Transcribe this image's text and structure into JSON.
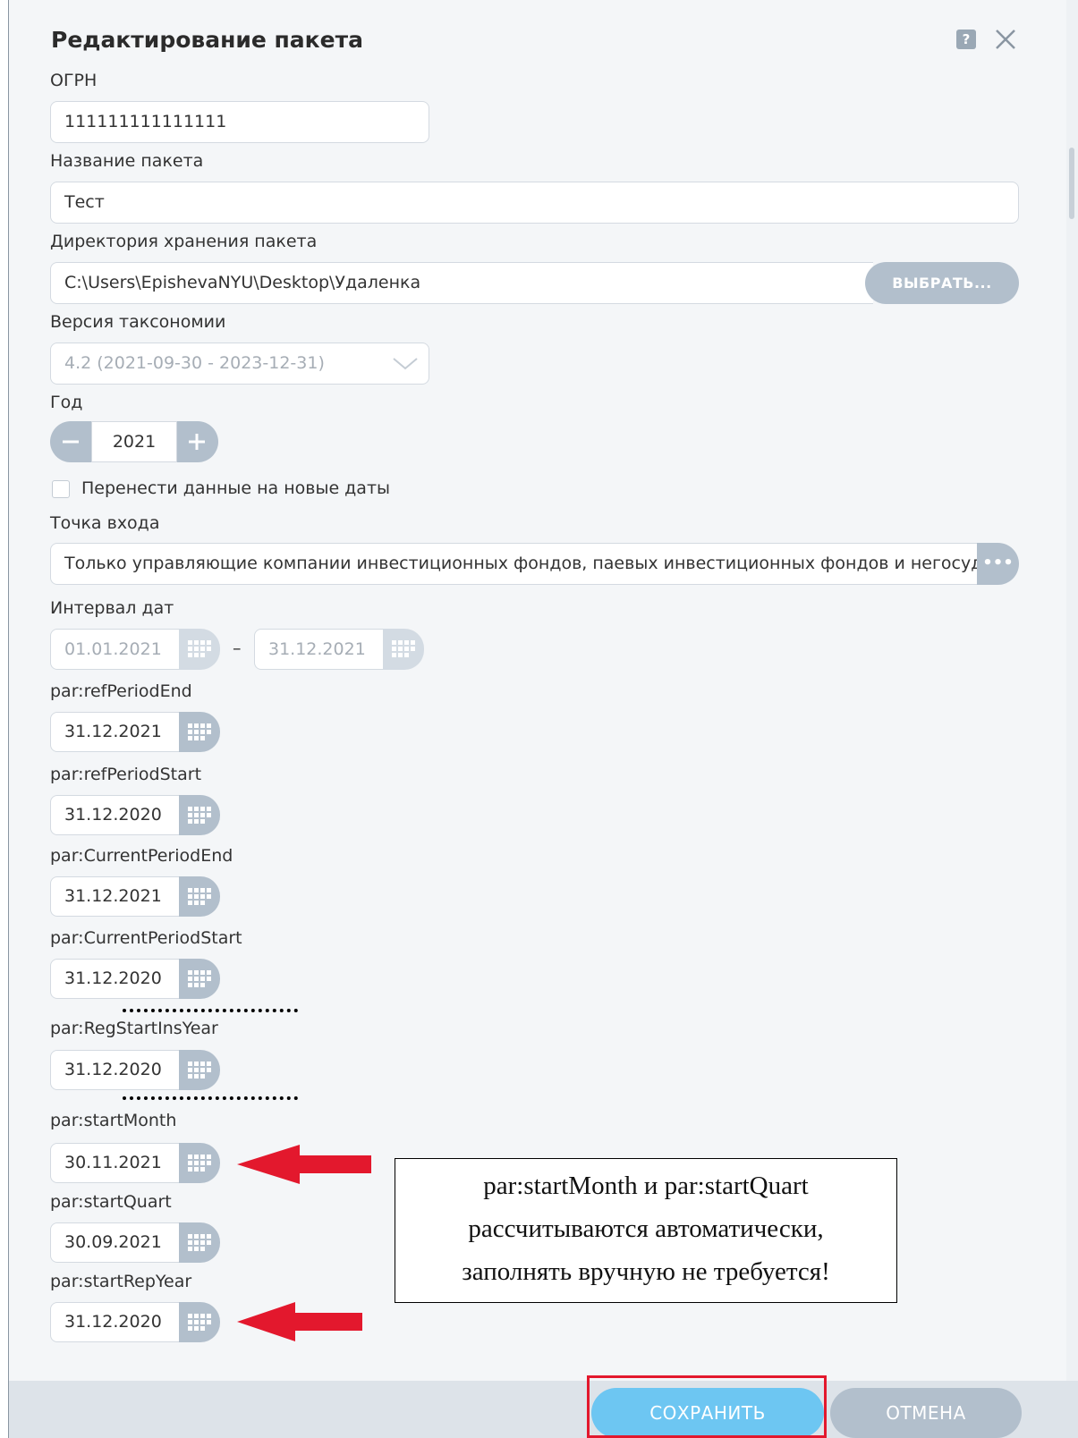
{
  "dialog": {
    "title": "Редактирование пакета",
    "help_icon": "question-mark-icon",
    "close_icon": "close-x-icon"
  },
  "form": {
    "ogrn": {
      "label": "ОГРН",
      "value": "111111111111111"
    },
    "package_name": {
      "label": "Название пакета",
      "value": "Тест"
    },
    "storage_dir": {
      "label": "Директория хранения пакета",
      "value": "C:\\Users\\EpishevaNYU\\Desktop\\Удаленка",
      "button": "ВЫБРАТЬ..."
    },
    "taxonomy": {
      "label": "Версия таксономии",
      "value": "4.2 (2021-09-30 - 2023-12-31)"
    },
    "year": {
      "label": "Год",
      "value": "2021",
      "minus": "−",
      "plus": "+"
    },
    "transfer": {
      "label": "Перенести данные на новые даты",
      "checked": false
    },
    "entry_point": {
      "label": "Точка входа",
      "value": "Только управляющие компании инвестиционных фондов, паевых инвестиционных фондов и негосударственных пенсионных фондов",
      "button": "•••"
    },
    "date_interval": {
      "label": "Интервал дат",
      "from": "01.01.2021",
      "separator": "–",
      "to": "31.12.2021"
    },
    "params": [
      {
        "label": "par:refPeriodEnd",
        "value": "31.12.2021"
      },
      {
        "label": "par:refPeriodStart",
        "value": "31.12.2020"
      },
      {
        "label": "par:CurrentPeriodEnd",
        "value": "31.12.2021"
      },
      {
        "label": "par:CurrentPeriodStart",
        "value": "31.12.2020"
      },
      {
        "label": "par:RegStartInsYear",
        "value": "31.12.2020"
      },
      {
        "label": "par:startMonth",
        "value": "30.11.2021"
      },
      {
        "label": "par:startQuart",
        "value": "30.09.2021"
      },
      {
        "label": "par:startRepYear",
        "value": "31.12.2020"
      }
    ]
  },
  "annotation": {
    "line1": "par:startMonth и par:startQuart",
    "line2": "рассчитываются автоматически,",
    "line3": "заполнять вручную не требуется!",
    "arrow_color": "#e3182d"
  },
  "footer": {
    "save": "СОХРАНИТЬ",
    "cancel": "ОТМЕНА"
  },
  "colors": {
    "accent": "#6dc6f2",
    "button_gray": "#b2bfcc",
    "highlight": "#e3182d"
  }
}
